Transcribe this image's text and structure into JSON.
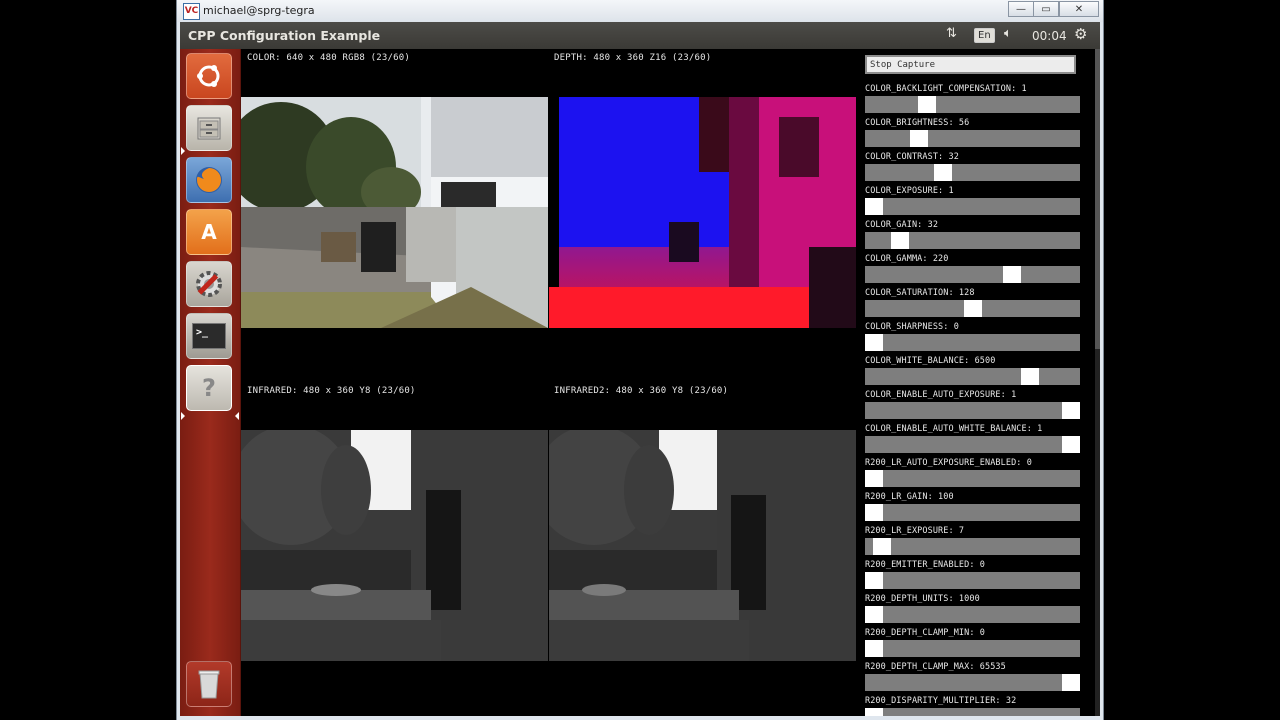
{
  "vnc": {
    "logo": "VC",
    "title": "michael@sprg-tegra",
    "buttons": {
      "minimize": "—",
      "restore": "▭",
      "close": "✕"
    }
  },
  "app": {
    "title": "CPP Configuration Example",
    "tray": {
      "network_icon": "transfer-arrows-icon",
      "language": "En",
      "volume_icon": "speaker-icon",
      "clock": "00:04",
      "settings_icon": "gear-icon"
    }
  },
  "launcher": {
    "items": [
      {
        "name": "ubuntu-dash",
        "icon": "ubuntu-logo-icon"
      },
      {
        "name": "files",
        "icon": "file-cabinet-icon"
      },
      {
        "name": "firefox",
        "icon": "firefox-icon"
      },
      {
        "name": "software-center",
        "icon": "shopping-bag-icon",
        "glyph": "A"
      },
      {
        "name": "system-settings",
        "icon": "settings-tools-icon"
      },
      {
        "name": "terminal",
        "icon": "terminal-icon",
        "glyph": ">_"
      },
      {
        "name": "help",
        "icon": "help-icon",
        "glyph": "?"
      },
      {
        "name": "trash",
        "icon": "trash-icon"
      }
    ]
  },
  "streams": {
    "color": "COLOR: 640 x 480 RGB8 (23/60)",
    "depth": "DEPTH: 480 x 360 Z16 (23/60)",
    "infrared": "INFRARED: 480 x 360 Y8 (23/60)",
    "infrared2": "INFRARED2: 480 x 360 Y8 (23/60)"
  },
  "panel": {
    "stop_capture": "Stop Capture",
    "controls": [
      {
        "label": "COLOR_BACKLIGHT_COMPENSATION: 1",
        "level": 0.27
      },
      {
        "label": "COLOR_BRIGHTNESS: 56",
        "level": 0.23
      },
      {
        "label": "COLOR_CONTRAST: 32",
        "level": 0.35
      },
      {
        "label": "COLOR_EXPOSURE: 1",
        "level": 0.0
      },
      {
        "label": "COLOR_GAIN: 32",
        "level": 0.13
      },
      {
        "label": "COLOR_GAMMA: 220",
        "level": 0.7
      },
      {
        "label": "COLOR_SATURATION: 128",
        "level": 0.5
      },
      {
        "label": "COLOR_SHARPNESS: 0",
        "level": 0.0
      },
      {
        "label": "COLOR_WHITE_BALANCE: 6500",
        "level": 0.79
      },
      {
        "label": "COLOR_ENABLE_AUTO_EXPOSURE: 1",
        "level": 1.0
      },
      {
        "label": "COLOR_ENABLE_AUTO_WHITE_BALANCE: 1",
        "level": 1.0
      },
      {
        "label": "R200_LR_AUTO_EXPOSURE_ENABLED: 0",
        "level": 0.0
      },
      {
        "label": "R200_LR_GAIN: 100",
        "level": 0.0
      },
      {
        "label": "R200_LR_EXPOSURE: 7",
        "level": 0.04
      },
      {
        "label": "R200_EMITTER_ENABLED: 0",
        "level": 0.0
      },
      {
        "label": "R200_DEPTH_UNITS: 1000",
        "level": 0.0
      },
      {
        "label": "R200_DEPTH_CLAMP_MIN: 0",
        "level": 0.0
      },
      {
        "label": "R200_DEPTH_CLAMP_MAX: 65535",
        "level": 1.0
      },
      {
        "label": "R200_DISPARITY_MULTIPLIER: 32",
        "level": 0.0
      }
    ]
  }
}
